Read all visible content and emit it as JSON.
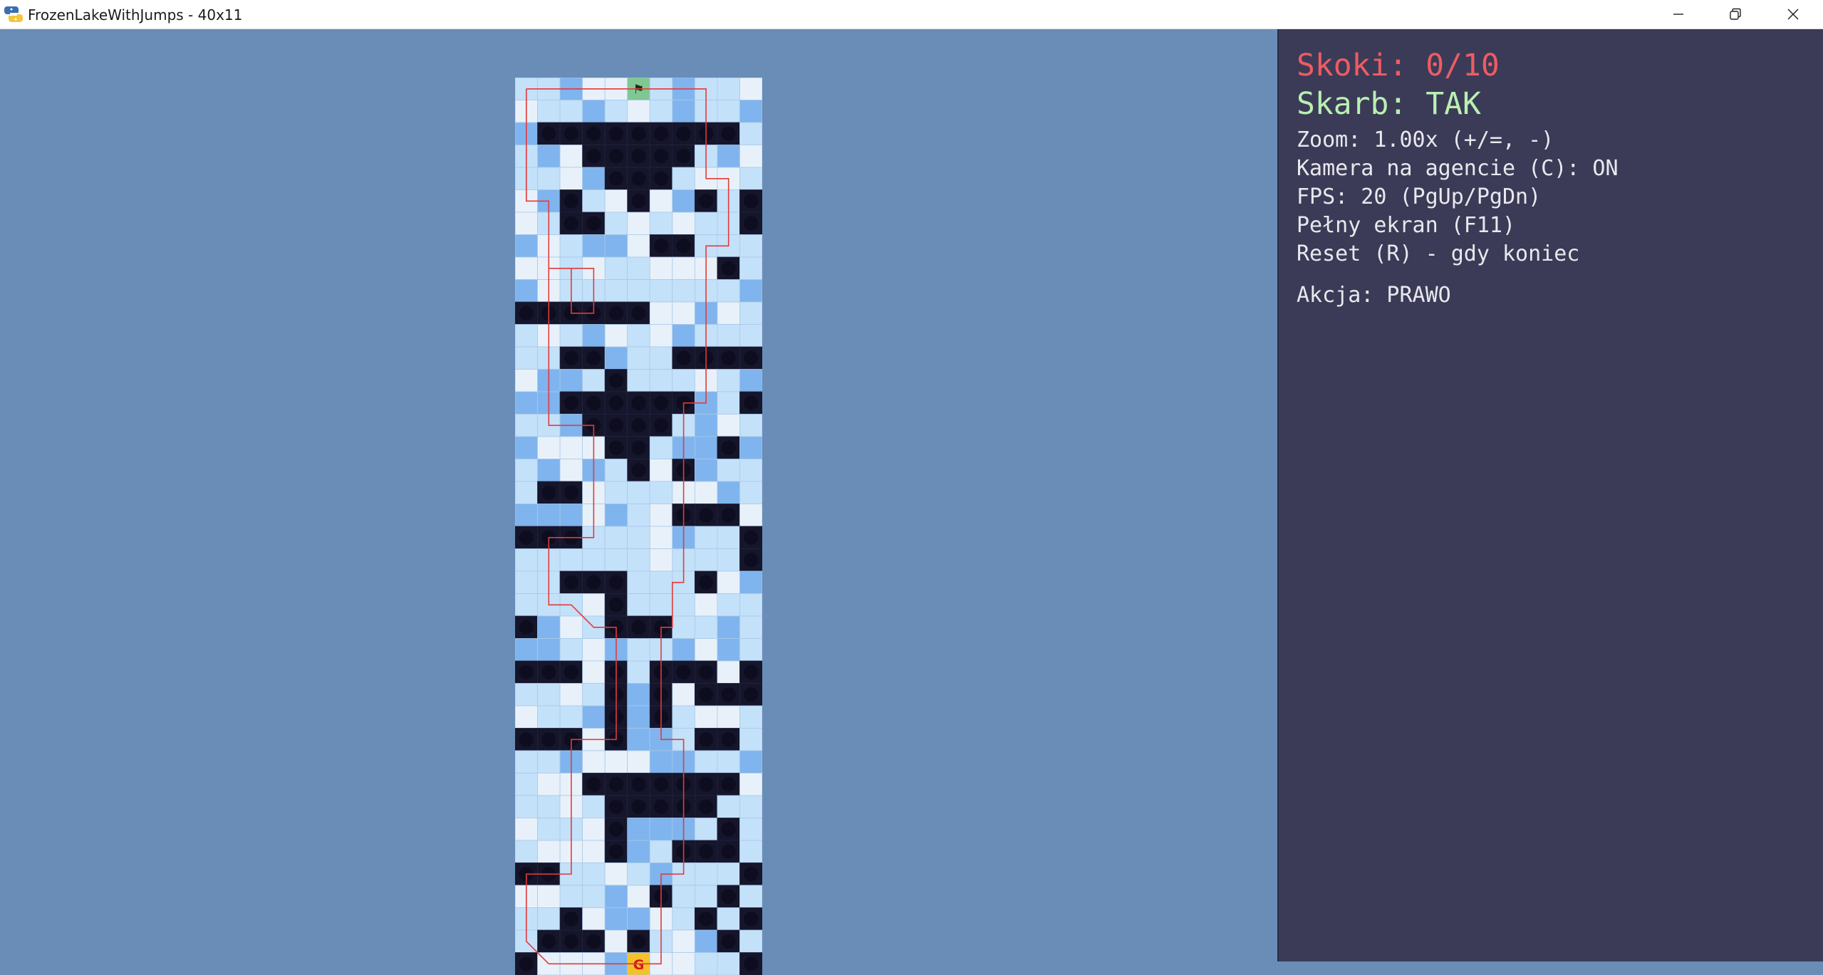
{
  "window": {
    "title": "FrozenLakeWithJumps - 40x11",
    "icon": "python-snake-icon",
    "controls": [
      "minimize-icon",
      "restore-icon",
      "close-icon"
    ]
  },
  "grid": {
    "rows": 40,
    "cols": 11,
    "legend": {
      "F": "frozen ice",
      "H": "hole",
      "S": "start (agent)",
      "G": "goal"
    },
    "map": [
      "FFFFFSFFFFF",
      "FFFFFFFFFFF",
      "FHHHHHHHHHF",
      "FFFHHHHHFFF",
      "FFFFHHHFFFF",
      "FFHFFHFFHFH",
      "FFHHFFFFFFH",
      "FFFFFFHHFFF",
      "FFFFFFFFFHF",
      "FFFFFFFFFFF",
      "HHHHHHFFFFF",
      "FFFFFFFFFFF",
      "FFHHFFFHHHH",
      "FFFFHFFFFFF",
      "FFHHHHHHFFH",
      "FFFHHHHFFFF",
      "FFFFHHFFFHF",
      "FFFFFHFHFFF",
      "FHHFFFFFFFF",
      "FFFFFFFHHHF",
      "HHHFFFFFFFH",
      "FFFFFFFFFFH",
      "FFHHHFFFHFF",
      "FFFFHFFFFFF",
      "HFFFHHHFFFF",
      "FFFFFFFFFFF",
      "HHHFHFHHHFH",
      "FFFFHFHFHHH",
      "FFFFHFHFFFF",
      "HHHFHFFFHHF",
      "FFFFFFFFFFF",
      "FFFHHHHHHHF",
      "FFFFHHHHHFF",
      "FFFFHFFFFHF",
      "FFFFHFFHHHF",
      "HHFFFFFFFFH",
      "FFFFFFHFFHF",
      "FFHFFFFFHFH",
      "FHHHFHFFFHF",
      "HFFFFGFFFFH"
    ],
    "agent_label": "⚑",
    "goal_label": "G",
    "path_color": "#e33a3a",
    "hole_color": "#15152b",
    "ice_color": "#c4e1fa",
    "deep_ice_color": "#7fb4ee"
  },
  "panel": {
    "jumps": "Skoki: 0/10",
    "treasure": "Skarb: TAK",
    "zoom": "Zoom: 1.00x (+/=, -)",
    "camera": "Kamera na agencie (C): ON",
    "fps": "FPS: 20 (PgUp/PgDn)",
    "fullscreen": "Pełny ekran (F11)",
    "reset": "Reset (R) - gdy koniec",
    "action": "Akcja: PRAWO",
    "colors": {
      "background": "#3b3b57",
      "jumps": "#ef5b63",
      "treasure": "#b9f0b1",
      "text": "#e8e8ee"
    }
  }
}
